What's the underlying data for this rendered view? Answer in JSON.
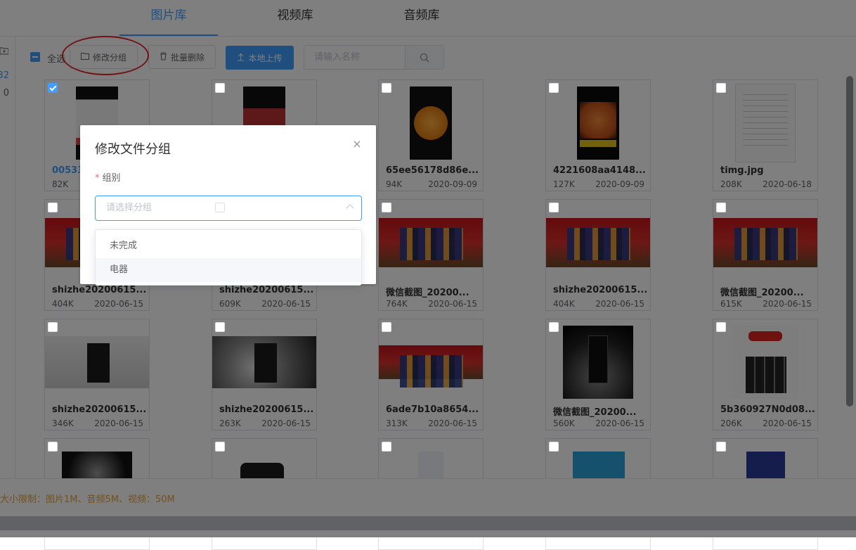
{
  "tabs": [
    {
      "label": "图片库",
      "active": true
    },
    {
      "label": "视频库",
      "active": false
    },
    {
      "label": "音频库",
      "active": false
    }
  ],
  "sidebar": {
    "count_a": "32",
    "count_b": "0"
  },
  "toolbar": {
    "select_all": "全选",
    "edit_group": "修改分组",
    "batch_delete": "批量删除",
    "upload": "本地上传",
    "search_placeholder": "请输入名称"
  },
  "cards": [
    {
      "name": "00533",
      "size": "82K",
      "date": ""
    },
    {
      "name": "",
      "size": "",
      "date": ""
    },
    {
      "name": "65ee56178d86e...",
      "size": "94K",
      "date": "2020-09-09"
    },
    {
      "name": "4221608aa4148...",
      "size": "127K",
      "date": "2020-09-09"
    },
    {
      "name": "timg.jpg",
      "size": "208K",
      "date": "2020-06-18"
    },
    {
      "name": "shizhe20200615...",
      "size": "404K",
      "date": "2020-06-15"
    },
    {
      "name": "shizhe20200615...",
      "size": "609K",
      "date": "2020-06-15"
    },
    {
      "name": "微信截图_20200...",
      "size": "764K",
      "date": "2020-06-15"
    },
    {
      "name": "shizhe20200615...",
      "size": "404K",
      "date": "2020-06-15"
    },
    {
      "name": "微信截图_20200...",
      "size": "615K",
      "date": "2020-06-15"
    },
    {
      "name": "shizhe20200615...",
      "size": "346K",
      "date": "2020-06-15"
    },
    {
      "name": "shizhe20200615...",
      "size": "263K",
      "date": "2020-06-15"
    },
    {
      "name": "6ade7b10a8654...",
      "size": "313K",
      "date": "2020-06-15"
    },
    {
      "name": "微信截图_20200...",
      "size": "560K",
      "date": "2020-06-15"
    },
    {
      "name": "5b360927N0d08...",
      "size": "206K",
      "date": "2020-06-15"
    }
  ],
  "footer": {
    "limit_text": "大小限制：图片1M、音频5M、视频：50M"
  },
  "dialog": {
    "title": "修改文件分组",
    "field_label": "组别",
    "select_placeholder": "请选择分组",
    "options": [
      "未完成",
      "电器"
    ],
    "close_symbol": "×"
  },
  "colors": {
    "primary": "#409eff",
    "annotation": "#e3262a",
    "warning": "#e6a23c"
  }
}
